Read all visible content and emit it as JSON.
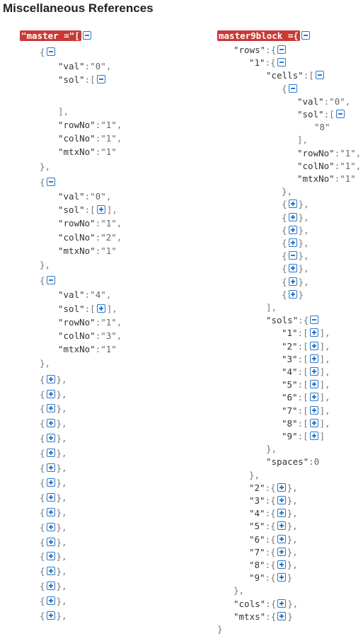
{
  "heading": "Miscellaneous References",
  "icons": {
    "expand": "plus-square-icon",
    "collapse": "minus-square-icon"
  },
  "colors": {
    "highlight": "#c93a36",
    "toggle": "#2a78c8"
  },
  "master": {
    "name": "\"master =\"",
    "open_bracket": "[",
    "expanded_items": [
      {
        "val": "\"0\"",
        "sol_open": true,
        "rowNo": "\"1\"",
        "colNo": "\"1\"",
        "mtxNo": "\"1\""
      },
      {
        "val": "\"0\"",
        "sol_open": false,
        "rowNo": "\"1\"",
        "colNo": "\"2\"",
        "mtxNo": "\"1\""
      },
      {
        "val": "\"4\"",
        "sol_open": false,
        "rowNo": "\"1\"",
        "colNo": "\"3\"",
        "mtxNo": "\"1\""
      }
    ],
    "collapsed_count": 17
  },
  "block": {
    "name": "master9block =",
    "open_brace": "{",
    "rows_key": "\"rows\"",
    "row1_key": "\"1\"",
    "cells_key": "\"cells\"",
    "first_cell": {
      "val": "\"0\"",
      "sol_value": "\"8\"",
      "rowNo": "\"1\"",
      "colNo": "\"1\"",
      "mtxNo": "\"1\""
    },
    "cells_collapsed": 8,
    "cells_expanded_index": 4,
    "sols_key": "\"sols\"",
    "sols": [
      "\"1\"",
      "\"2\"",
      "\"3\"",
      "\"4\"",
      "\"5\"",
      "\"6\"",
      "\"7\"",
      "\"8\"",
      "\"9\""
    ],
    "spaces_key": "\"spaces\"",
    "spaces_value": "0",
    "other_rows": [
      "\"2\"",
      "\"3\"",
      "\"4\"",
      "\"5\"",
      "\"6\"",
      "\"7\"",
      "\"8\"",
      "\"9\""
    ],
    "cols_key": "\"cols\"",
    "mtxs_key": "\"mtxs\""
  },
  "keys": {
    "val": "\"val\"",
    "sol": "\"sol\"",
    "rowNo": "\"rowNo\"",
    "colNo": "\"colNo\"",
    "mtxNo": "\"mtxNo\""
  }
}
